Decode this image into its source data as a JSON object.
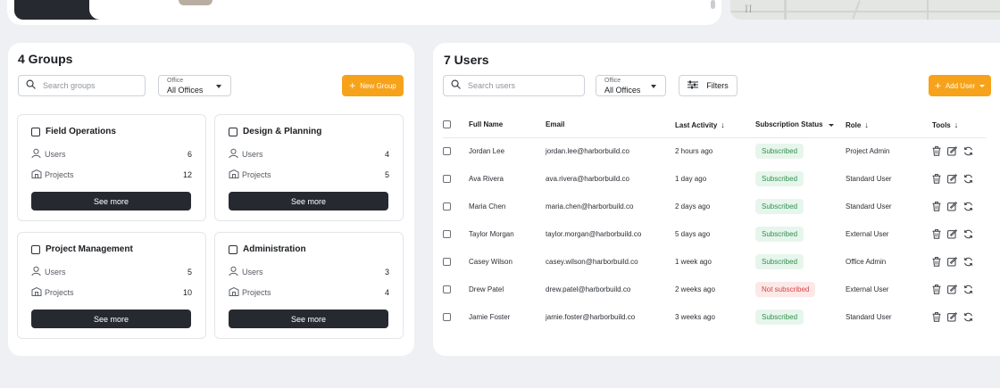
{
  "top": {
    "map_label": "ĵ ĵ"
  },
  "groups_panel": {
    "title": "4 Groups",
    "search_placeholder": "Search groups",
    "office_filter": {
      "label": "Office",
      "value": "All Offices"
    },
    "new_group_label": "New Group",
    "cards": [
      {
        "title": "Field Operations",
        "users_label": "Users",
        "users": "6",
        "projects_label": "Projects",
        "projects": "12",
        "button": "See more"
      },
      {
        "title": "Design & Planning",
        "users_label": "Users",
        "users": "4",
        "projects_label": "Projects",
        "projects": "5",
        "button": "See more"
      },
      {
        "title": "Project Management",
        "users_label": "Users",
        "users": "5",
        "projects_label": "Projects",
        "projects": "10",
        "button": "See more"
      },
      {
        "title": "Administration",
        "users_label": "Users",
        "users": "3",
        "projects_label": "Projects",
        "projects": "4",
        "button": "See more"
      }
    ]
  },
  "users_panel": {
    "title": "7 Users",
    "search_placeholder": "Search users",
    "office_filter": {
      "label": "Office",
      "value": "All Offices"
    },
    "filters_label": "Filters",
    "add_user_label": "Add User",
    "columns": {
      "full_name": "Full Name",
      "email": "Email",
      "last_activity": "Last Activity",
      "subscription": "Subscription Status",
      "role": "Role",
      "tools": "Tools"
    },
    "rows": [
      {
        "name": "Jordan Lee",
        "email": "jordan.lee@harborbuild.co",
        "activity": "2 hours ago",
        "status": "Subscribed",
        "subscribed": true,
        "role": "Project Admin"
      },
      {
        "name": "Ava Rivera",
        "email": "ava.rivera@harborbuild.co",
        "activity": "1 day ago",
        "status": "Subscribed",
        "subscribed": true,
        "role": "Standard User"
      },
      {
        "name": "Maria Chen",
        "email": "maria.chen@harborbuild.co",
        "activity": "2 days ago",
        "status": "Subscribed",
        "subscribed": true,
        "role": "Standard User"
      },
      {
        "name": "Taylor Morgan",
        "email": "taylor.morgan@harborbuild.co",
        "activity": "5 days ago",
        "status": "Subscribed",
        "subscribed": true,
        "role": "External User"
      },
      {
        "name": "Casey Wilson",
        "email": "casey.wilson@harborbuild.co",
        "activity": "1 week ago",
        "status": "Subscribed",
        "subscribed": true,
        "role": "Office Admin"
      },
      {
        "name": "Drew Patel",
        "email": "drew.patel@harborbuild.co",
        "activity": "2 weeks ago",
        "status": "Not subscribed",
        "subscribed": false,
        "role": "External User"
      },
      {
        "name": "Jamie Foster",
        "email": "jamie.foster@harborbuild.co",
        "activity": "3 weeks ago",
        "status": "Subscribed",
        "subscribed": true,
        "role": "Standard User"
      }
    ]
  },
  "icons": {
    "search": "search-icon",
    "user": "user-icon",
    "projects": "projects-icon",
    "filters": "filter-icon",
    "delete": "trash-icon",
    "edit": "edit-icon",
    "sync": "sync-icon"
  },
  "colors": {
    "accent": "#f7a21b",
    "dark_button": "#262a30",
    "subscribed_bg": "#e7f6ec",
    "subscribed_text": "#2f8f4e",
    "not_subscribed_bg": "#fde8e8",
    "not_subscribed_text": "#d64545"
  }
}
